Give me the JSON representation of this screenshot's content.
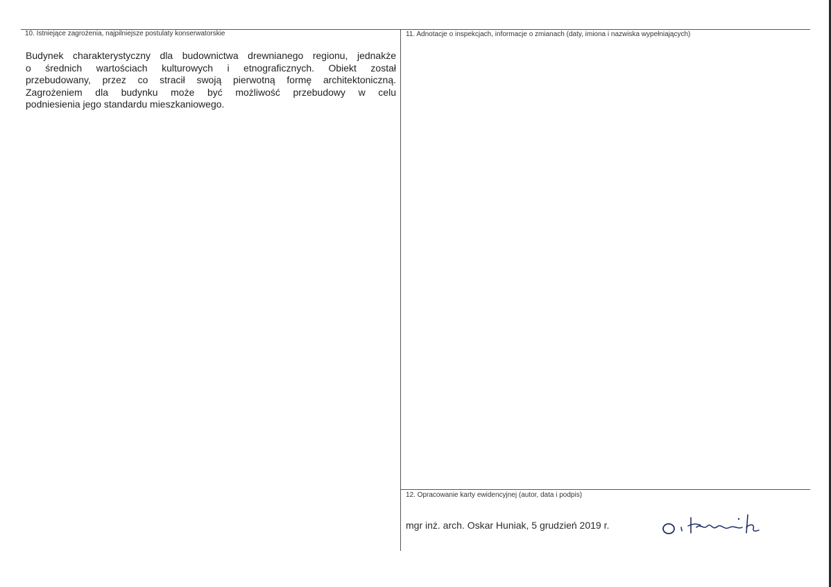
{
  "section10": {
    "label": "10. Istniejące zagrożenia, najpilniejsze postulaty konserwatorskie",
    "lines": [
      "Budynek charakterystyczny dla budownictwa drewnianego regionu, jednakże",
      "o średnich wartościach kulturowych i etnograficznych. Obiekt został",
      "przebudowany, przez co stracił swoją pierwotną formę architektoniczną.",
      "Zagrożeniem dla budynku może być możliwość przebudowy w celu",
      "podniesienia jego standardu mieszkaniowego."
    ]
  },
  "section11": {
    "label": "11. Adnotacje o inspekcjach, informacje o zmianach (daty, imiona i nazwiska wypełniających)"
  },
  "section12": {
    "label": "12. Opracowanie karty ewidencyjnej (autor, data i podpis)",
    "author_line": "mgr inż. arch. Oskar Huniak, 5 grudzień 2019 r."
  },
  "signature": {
    "icon": "handwritten-signature"
  }
}
